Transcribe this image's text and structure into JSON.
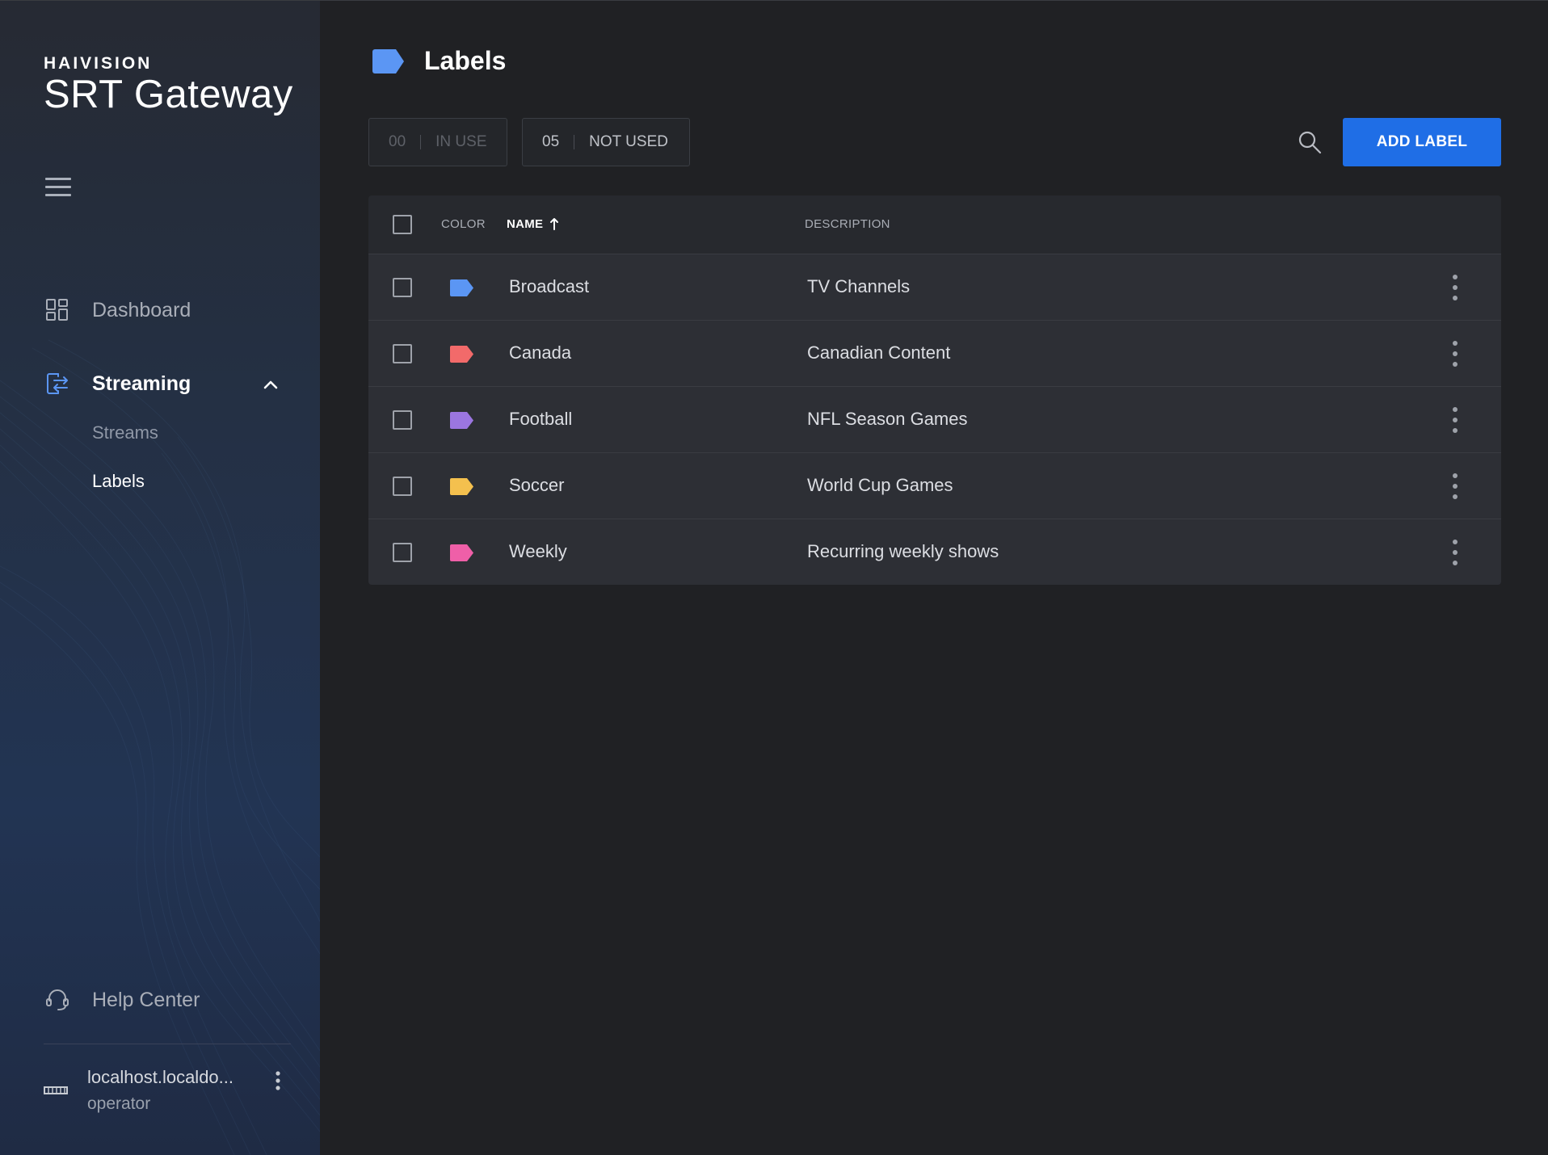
{
  "brand": {
    "company": "HAIVISION",
    "product": "SRT Gateway"
  },
  "sidebar": {
    "menu_icon": "hamburger-icon",
    "nav": {
      "dashboard": {
        "label": "Dashboard",
        "icon": "dashboard-grid-icon"
      },
      "streaming": {
        "label": "Streaming",
        "icon": "streaming-transfer-icon",
        "expanded": true,
        "children": [
          {
            "label": "Streams",
            "active": false
          },
          {
            "label": "Labels",
            "active": true
          }
        ]
      },
      "help": {
        "label": "Help Center",
        "icon": "headset-icon"
      }
    },
    "host": {
      "name": "localhost.localdo...",
      "role": "operator",
      "icon": "server-icon"
    }
  },
  "page": {
    "title": "Labels",
    "title_icon": "label-tag-icon",
    "title_icon_color": "#5b96f4"
  },
  "counters": {
    "in_use": {
      "count": "00",
      "label": "IN USE"
    },
    "not_used": {
      "count": "05",
      "label": "NOT USED"
    }
  },
  "toolbar": {
    "search_icon": "search-icon",
    "add_label": "ADD LABEL"
  },
  "table": {
    "columns": {
      "color": "COLOR",
      "name": "NAME",
      "description": "DESCRIPTION"
    },
    "sort": {
      "column": "name",
      "direction": "ascending"
    },
    "rows": [
      {
        "name": "Broadcast",
        "description": "TV Channels",
        "color": "#5b96f4"
      },
      {
        "name": "Canada",
        "description": "Canadian Content",
        "color": "#f26a6a"
      },
      {
        "name": "Football",
        "description": "NFL Season Games",
        "color": "#9b76e0"
      },
      {
        "name": "Soccer",
        "description": "World Cup Games",
        "color": "#f4c04e"
      },
      {
        "name": "Weekly",
        "description": "Recurring weekly shows",
        "color": "#ef5fa8"
      }
    ]
  },
  "colors": {
    "accent": "#1f6ee6",
    "background": "#202124",
    "table_row": "#2d2f35"
  }
}
